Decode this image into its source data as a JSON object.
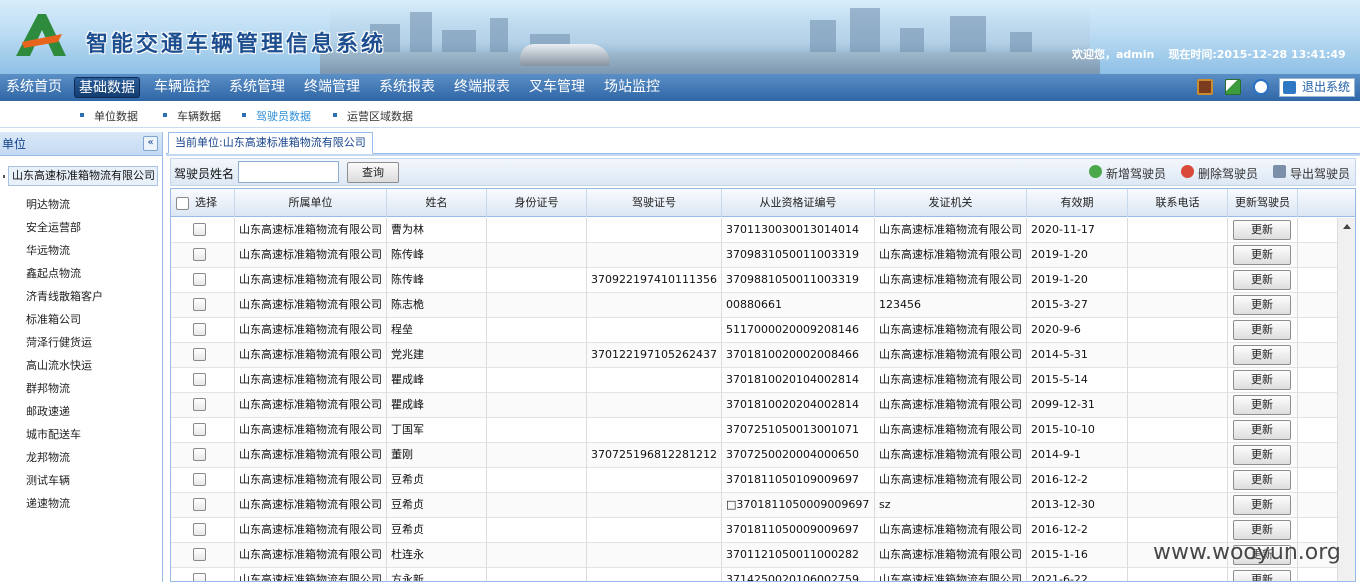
{
  "header": {
    "title": "智能交通车辆管理信息系统",
    "welcome": "欢迎您，admin",
    "current_time": "现在时间:2015-12-28 13:41:49"
  },
  "nav": {
    "items": [
      "系统首页",
      "基础数据",
      "车辆监控",
      "系统管理",
      "终端管理",
      "系统报表",
      "终端报表",
      "叉车管理",
      "场站监控"
    ],
    "active": "基础数据",
    "logout_label": "退出系统"
  },
  "subnav": {
    "items": [
      "单位数据",
      "车辆数据",
      "驾驶员数据",
      "运营区域数据"
    ],
    "active": "驾驶员数据"
  },
  "left_panel": {
    "title": "单位",
    "collapse_glyph": "«",
    "root": "山东高速标准箱物流有限公司",
    "children": [
      "明达物流",
      "安全运营部",
      "华远物流",
      "鑫起点物流",
      "济青线散箱客户",
      "标准箱公司",
      "菏泽行健货运",
      "高山流水快运",
      "群邦物流",
      "邮政速递",
      "城市配送车",
      "龙邦物流",
      "测试车辆",
      "递速物流"
    ]
  },
  "main": {
    "tab_label": "当前单位:山东高速标准箱物流有限公司",
    "search_label": "驾驶员姓名",
    "search_value": "",
    "search_button": "查询",
    "actions": {
      "add": "新增驾驶员",
      "delete": "删除驾驶员",
      "export": "导出驾驶员"
    }
  },
  "grid": {
    "columns": [
      "选择",
      "所属单位",
      "姓名",
      "身份证号",
      "驾驶证号",
      "从业资格证编号",
      "发证机关",
      "有效期",
      "联系电话",
      "更新驾驶员"
    ],
    "update_label": "更新",
    "rows": [
      [
        "山东高速标准箱物流有限公司",
        "曹为林",
        "",
        "",
        "370113003001301​4014",
        "山东高速标准箱物流有限公司",
        "2020-11-17",
        ""
      ],
      [
        "山东高速标准箱物流有限公司",
        "陈传峰",
        "",
        "",
        "370983105001100​3319",
        "山东高速标准箱物流有限公司",
        "2019-1-20",
        ""
      ],
      [
        "山东高速标准箱物流有限公司",
        "陈传峰",
        "",
        "370922197410111356",
        "370988105001100​3319",
        "山东高速标准箱物流有限公司",
        "2019-1-20",
        ""
      ],
      [
        "山东高速标准箱物流有限公司",
        "陈志桅",
        "",
        "",
        "00880661",
        "123456",
        "2015-3-27",
        ""
      ],
      [
        "山东高速标准箱物流有限公司",
        "程垒",
        "",
        "",
        "511700002000920​8146",
        "山东高速标准箱物流有限公司",
        "2020-9-6",
        ""
      ],
      [
        "山东高速标准箱物流有限公司",
        "党兆建",
        "",
        "370122197105262437",
        "370181002000200​8466",
        "山东高速标准箱物流有限公司",
        "2014-5-31",
        ""
      ],
      [
        "山东高速标准箱物流有限公司",
        "瞿成峰",
        "",
        "",
        "370181002010400​2814",
        "山东高速标准箱物流有限公司",
        "2015-5-14",
        ""
      ],
      [
        "山东高速标准箱物流有限公司",
        "瞿成峰",
        "",
        "",
        "370181002020400​2814",
        "山东高速标准箱物流有限公司",
        "2099-12-31",
        ""
      ],
      [
        "山东高速标准箱物流有限公司",
        "丁国军",
        "",
        "",
        "370725105001300​1071",
        "山东高速标准箱物流有限公司",
        "2015-10-10",
        ""
      ],
      [
        "山东高速标准箱物流有限公司",
        "董刚",
        "",
        "370725196812281212",
        "370725002000400​0650",
        "山东高速标准箱物流有限公司",
        "2014-9-1",
        ""
      ],
      [
        "山东高速标准箱物流有限公司",
        "豆希贞",
        "",
        "",
        "370181105010900​9697",
        "山东高速标准箱物流有限公司",
        "2016-12-2",
        ""
      ],
      [
        "山东高速标准箱物流有限公司",
        "豆希贞",
        "",
        "",
        "□3701811050009009697",
        "sz",
        "2013-12-30",
        ""
      ],
      [
        "山东高速标准箱物流有限公司",
        "豆希贞",
        "",
        "",
        "370181105000900​9697",
        "山东高速标准箱物流有限公司",
        "2016-12-2",
        ""
      ],
      [
        "山东高速标准箱物流有限公司",
        "杜连永",
        "",
        "",
        "370112105001100​0282",
        "山东高速标准箱物流有限公司",
        "2015-1-16",
        ""
      ],
      [
        "山东高速标准箱物流有限公司",
        "方永新",
        "",
        "",
        "371425002010600​2759",
        "山东高速标准箱物流有限公司",
        "2021-6-22",
        ""
      ]
    ]
  },
  "watermark": "www.wooyun.org",
  "colors": {
    "nav_bg": "#2f66a6",
    "panel_border": "#99bbe8",
    "subnav_active": "#2f8fd8"
  }
}
